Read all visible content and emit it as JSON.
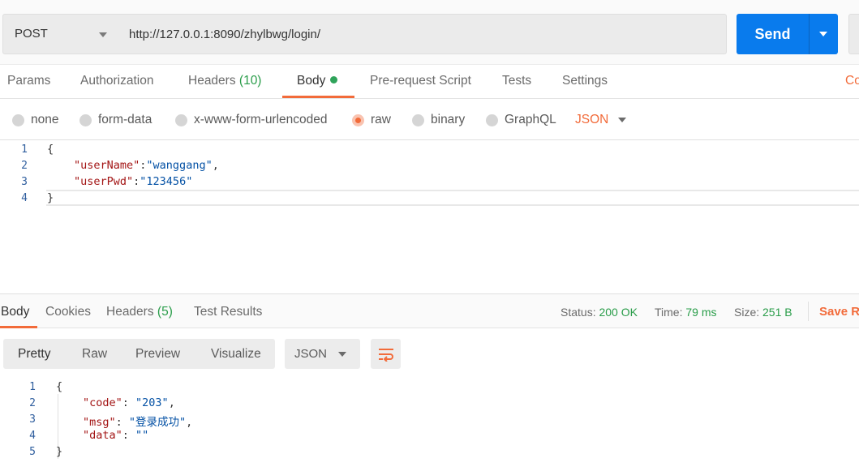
{
  "request": {
    "method": "POST",
    "url": "http://127.0.0.1:8090/zhylbwg/login/",
    "send_label": "Send"
  },
  "request_tabs": [
    {
      "label": "Params"
    },
    {
      "label": "Authorization"
    },
    {
      "label": "Headers",
      "count": "(10)"
    },
    {
      "label": "Body",
      "active": true
    },
    {
      "label": "Pre-request Script"
    },
    {
      "label": "Tests"
    },
    {
      "label": "Settings"
    }
  ],
  "request_tabs_right_partial": "Co",
  "body_types": [
    {
      "label": "none"
    },
    {
      "label": "form-data"
    },
    {
      "label": "x-www-form-urlencoded"
    },
    {
      "label": "raw",
      "selected": true
    },
    {
      "label": "binary"
    },
    {
      "label": "GraphQL"
    }
  ],
  "body_format": "JSON",
  "request_body": {
    "line_numbers": [
      "1",
      "2",
      "3",
      "4"
    ],
    "lines": [
      {
        "open": "{"
      },
      {
        "key": "\"userName\"",
        "sep": ":",
        "value": "\"wanggang\"",
        "end": ","
      },
      {
        "key": "\"userPwd\"",
        "sep": ":",
        "value": "\"123456\"",
        "end": ""
      },
      {
        "close": "}"
      }
    ]
  },
  "response_tabs": [
    {
      "label": "Body",
      "active": true
    },
    {
      "label": "Cookies"
    },
    {
      "label": "Headers",
      "count": "(5)"
    },
    {
      "label": "Test Results"
    }
  ],
  "response_meta": {
    "status_label": "Status:",
    "status_value": "200 OK",
    "time_label": "Time:",
    "time_value": "79 ms",
    "size_label": "Size:",
    "size_value": "251 B",
    "save_label": "Save Re"
  },
  "view_modes": [
    "Pretty",
    "Raw",
    "Preview",
    "Visualize"
  ],
  "response_format": "JSON",
  "response_body": {
    "line_numbers": [
      "1",
      "2",
      "3",
      "4",
      "5"
    ],
    "open": "{",
    "lines": [
      {
        "key": "\"code\"",
        "sep": ": ",
        "value": "\"203\"",
        "end": ","
      },
      {
        "key": "\"msg\"",
        "sep": ": ",
        "value": "\"登录成功\"",
        "end": ","
      },
      {
        "key": "\"data\"",
        "sep": ": ",
        "value": "\"\"",
        "end": ""
      }
    ],
    "close": "}"
  },
  "colors": {
    "accent": "#f26b3a",
    "send": "#097bed",
    "ok": "#2a9d4a"
  },
  "icons": [
    "caret-down-icon",
    "wrap-lines-icon",
    "active-dot-icon"
  ]
}
